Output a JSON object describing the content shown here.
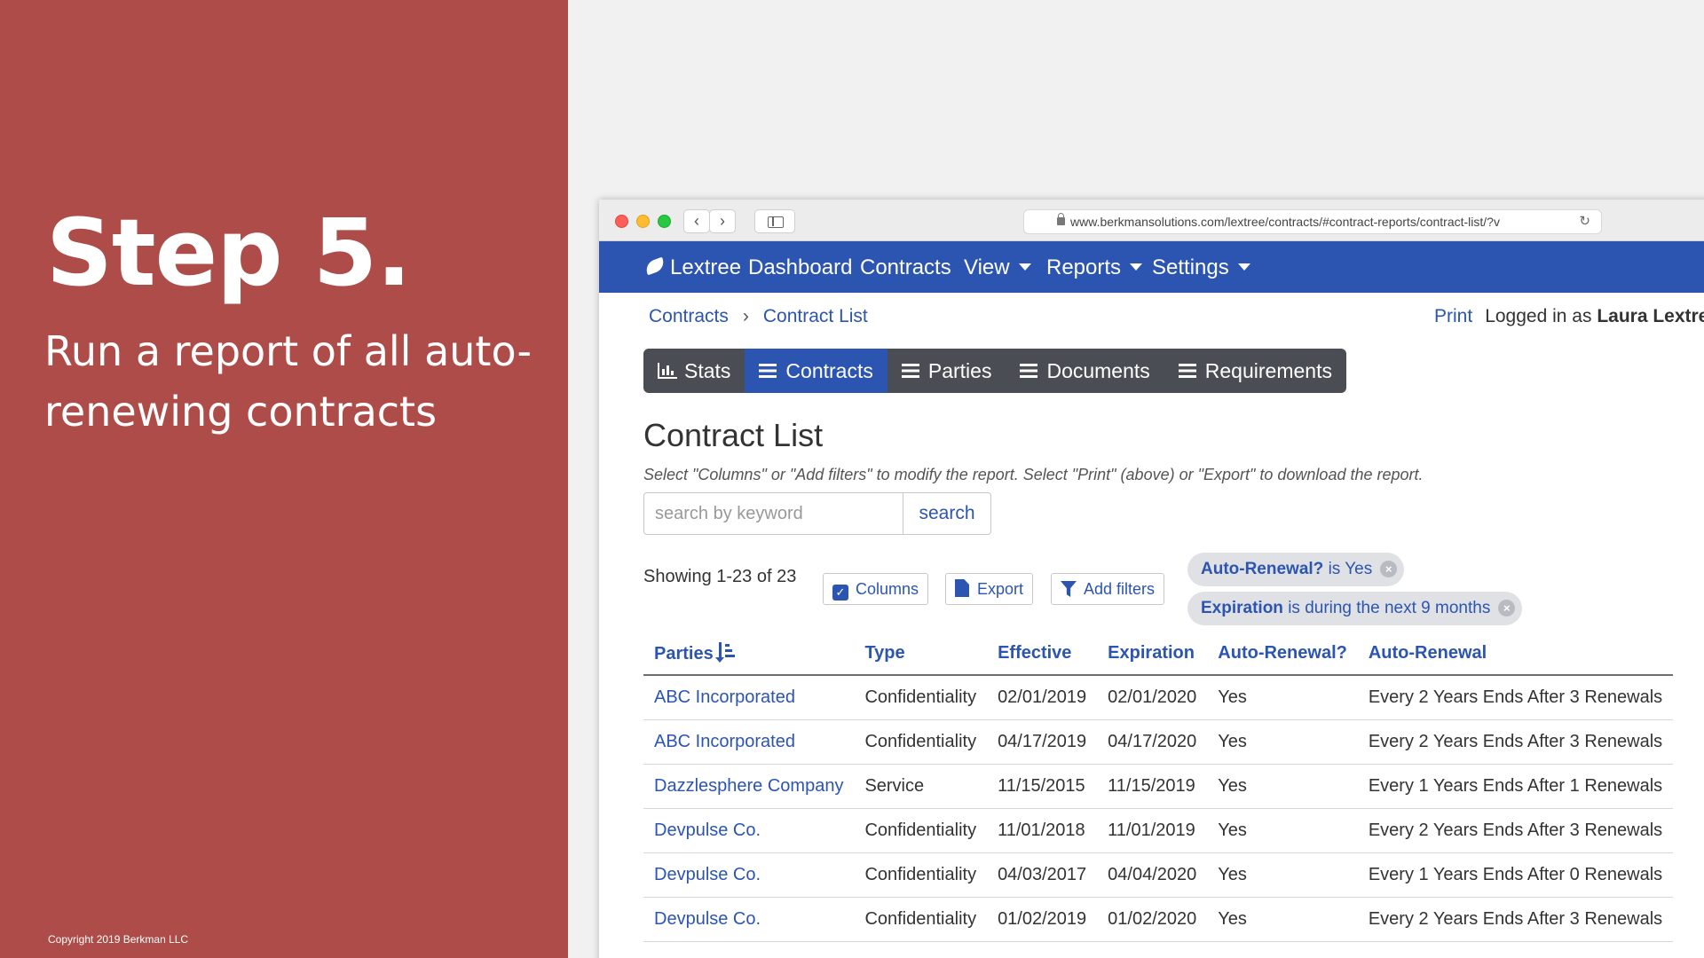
{
  "slide": {
    "step_title": "Step 5.",
    "step_description": "Run a report of all auto-renewing contracts",
    "copyright": "Copyright 2019 Berkman LLC",
    "background_color": "#ad4c48"
  },
  "browser": {
    "url": "www.berkmansolutions.com/lextree/contracts/#contract-reports/contract-list/?v",
    "icons": [
      "back-icon",
      "forward-icon",
      "sidebar-icon",
      "lock-icon",
      "reload-icon"
    ]
  },
  "navbar": {
    "brand": "Lextree",
    "items": [
      {
        "label": "Dashboard",
        "dropdown": false
      },
      {
        "label": "Contracts",
        "dropdown": false
      },
      {
        "label": "View",
        "dropdown": true
      },
      {
        "label": "Reports",
        "dropdown": true
      },
      {
        "label": "Settings",
        "dropdown": true
      }
    ],
    "color": "#2c55b1"
  },
  "breadcrumb": [
    "Contracts",
    "Contract List"
  ],
  "header_right": {
    "print": "Print",
    "logged_in_as": "Logged in as",
    "user": "Laura Lextree"
  },
  "tabs": [
    {
      "label": "Stats",
      "icon": "bar-chart-icon",
      "active": false
    },
    {
      "label": "Contracts",
      "icon": "list-icon",
      "active": true
    },
    {
      "label": "Parties",
      "icon": "list-icon",
      "active": false
    },
    {
      "label": "Documents",
      "icon": "list-icon",
      "active": false
    },
    {
      "label": "Requirements",
      "icon": "list-icon",
      "active": false
    }
  ],
  "page": {
    "title": "Contract List",
    "help_text": "Select \"Columns\" or \"Add filters\" to modify the report. Select \"Print\" (above) or \"Export\" to download the report.",
    "search_placeholder": "search by keyword",
    "search_button": "search",
    "showing": "Showing 1-23 of 23"
  },
  "toolbar": {
    "columns": "Columns",
    "export": "Export",
    "add_filters": "Add filters"
  },
  "filters": [
    {
      "field": "Auto-Renewal?",
      "condition": "is Yes"
    },
    {
      "field": "Expiration",
      "condition": "is during the next 9 months"
    }
  ],
  "table": {
    "columns": [
      "Parties",
      "Type",
      "Effective",
      "Expiration",
      "Auto-Renewal?",
      "Auto-Renewal"
    ],
    "rows": [
      [
        "ABC Incorporated",
        "Confidentiality",
        "02/01/2019",
        "02/01/2020",
        "Yes",
        "Every 2 Years Ends After 3 Renewals"
      ],
      [
        "ABC Incorporated",
        "Confidentiality",
        "04/17/2019",
        "04/17/2020",
        "Yes",
        "Every 2 Years Ends After 3 Renewals"
      ],
      [
        "Dazzlesphere Company",
        "Service",
        "11/15/2015",
        "11/15/2019",
        "Yes",
        "Every 1 Years Ends After 1 Renewals"
      ],
      [
        "Devpulse Co.",
        "Confidentiality",
        "11/01/2018",
        "11/01/2019",
        "Yes",
        "Every 2 Years Ends After 3 Renewals"
      ],
      [
        "Devpulse Co.",
        "Confidentiality",
        "04/03/2017",
        "04/04/2020",
        "Yes",
        "Every 1 Years Ends After 0 Renewals"
      ],
      [
        "Devpulse Co.",
        "Confidentiality",
        "01/02/2019",
        "01/02/2020",
        "Yes",
        "Every 2 Years Ends After 3 Renewals"
      ]
    ]
  }
}
